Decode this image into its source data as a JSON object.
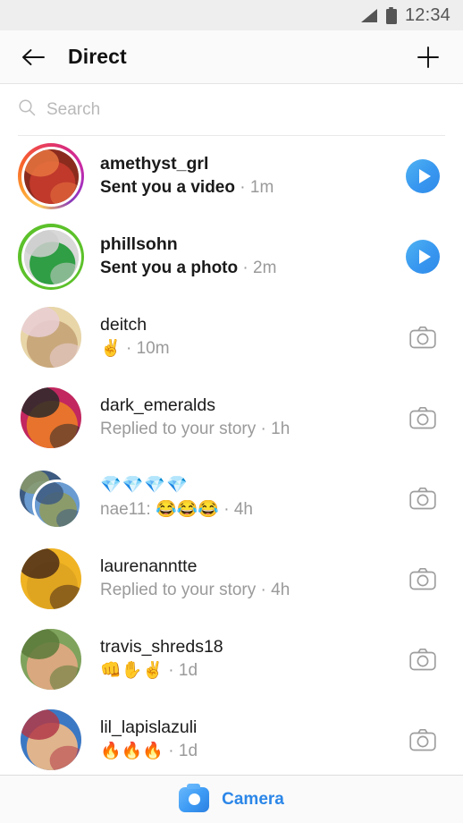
{
  "statusbar": {
    "time": "12:34",
    "signal_icon": "signal-icon",
    "battery_icon": "battery-icon"
  },
  "header": {
    "title": "Direct",
    "back_icon": "back-arrow-icon",
    "new_message_icon": "plus-icon"
  },
  "search": {
    "placeholder": "Search",
    "icon": "search-icon",
    "value": ""
  },
  "threads": [
    {
      "username": "amethyst_grl",
      "preview": "Sent you a video",
      "timestamp": "1m",
      "unread": true,
      "ring": "gradient",
      "action_icon": "play-icon",
      "avatar_colors": [
        "#8b2b1e",
        "#c0392b",
        "#e8743f"
      ]
    },
    {
      "username": "phillsohn",
      "preview": "Sent you a photo",
      "timestamp": "2m",
      "unread": true,
      "ring": "green",
      "action_icon": "play-icon",
      "avatar_colors": [
        "#d8d8d8",
        "#2f9e44",
        "#cfcfcf"
      ]
    },
    {
      "username": "deitch",
      "preview": "✌️",
      "timestamp": "10m",
      "unread": false,
      "ring": "none",
      "action_icon": "camera-outline-icon",
      "avatar_colors": [
        "#e8d6a8",
        "#c9a87c",
        "#e9cfd6"
      ]
    },
    {
      "username": "dark_emeralds",
      "preview": "Replied to your story",
      "timestamp": "1h",
      "unread": false,
      "ring": "none",
      "action_icon": "camera-outline-icon",
      "avatar_colors": [
        "#c2275f",
        "#e8732c",
        "#2a2a2a"
      ]
    },
    {
      "username": "💎💎💎💎",
      "emoji_title": true,
      "preview": "nae11: 😂😂😂",
      "timestamp": "4h",
      "unread": false,
      "ring": "none",
      "group": true,
      "action_icon": "camera-outline-icon",
      "avatar_colors": [
        "#6a9bd1",
        "#8b9b6a",
        "#3d5a80"
      ]
    },
    {
      "username": "laurenanntte",
      "preview": "Replied to your story",
      "timestamp": "4h",
      "unread": false,
      "ring": "none",
      "action_icon": "camera-outline-icon",
      "avatar_colors": [
        "#f0b323",
        "#e0a520",
        "#4a2c18"
      ]
    },
    {
      "username": "travis_shreds18",
      "preview": "👊✋✌️",
      "timestamp": "1d",
      "unread": false,
      "ring": "none",
      "action_icon": "camera-outline-icon",
      "avatar_colors": [
        "#7fa35c",
        "#d9a87e",
        "#5b7a3a"
      ]
    },
    {
      "username": "lil_lapislazuli",
      "preview": "🔥🔥🔥",
      "timestamp": "1d",
      "unread": false,
      "ring": "none",
      "action_icon": "camera-outline-icon",
      "avatar_colors": [
        "#3b78c4",
        "#e0b48c",
        "#b23a48"
      ]
    }
  ],
  "bottom_bar": {
    "camera_label": "Camera",
    "camera_icon": "camera-icon"
  },
  "colors": {
    "accent_blue": "#3897f0",
    "camera_label_blue": "#2b86e8",
    "close_friends_green": "#5cc12a",
    "unread_text": "#1a1a1a",
    "muted_text": "#9a9a9a",
    "statusbar_bg": "#eeeeee"
  },
  "separator_dot": "·"
}
